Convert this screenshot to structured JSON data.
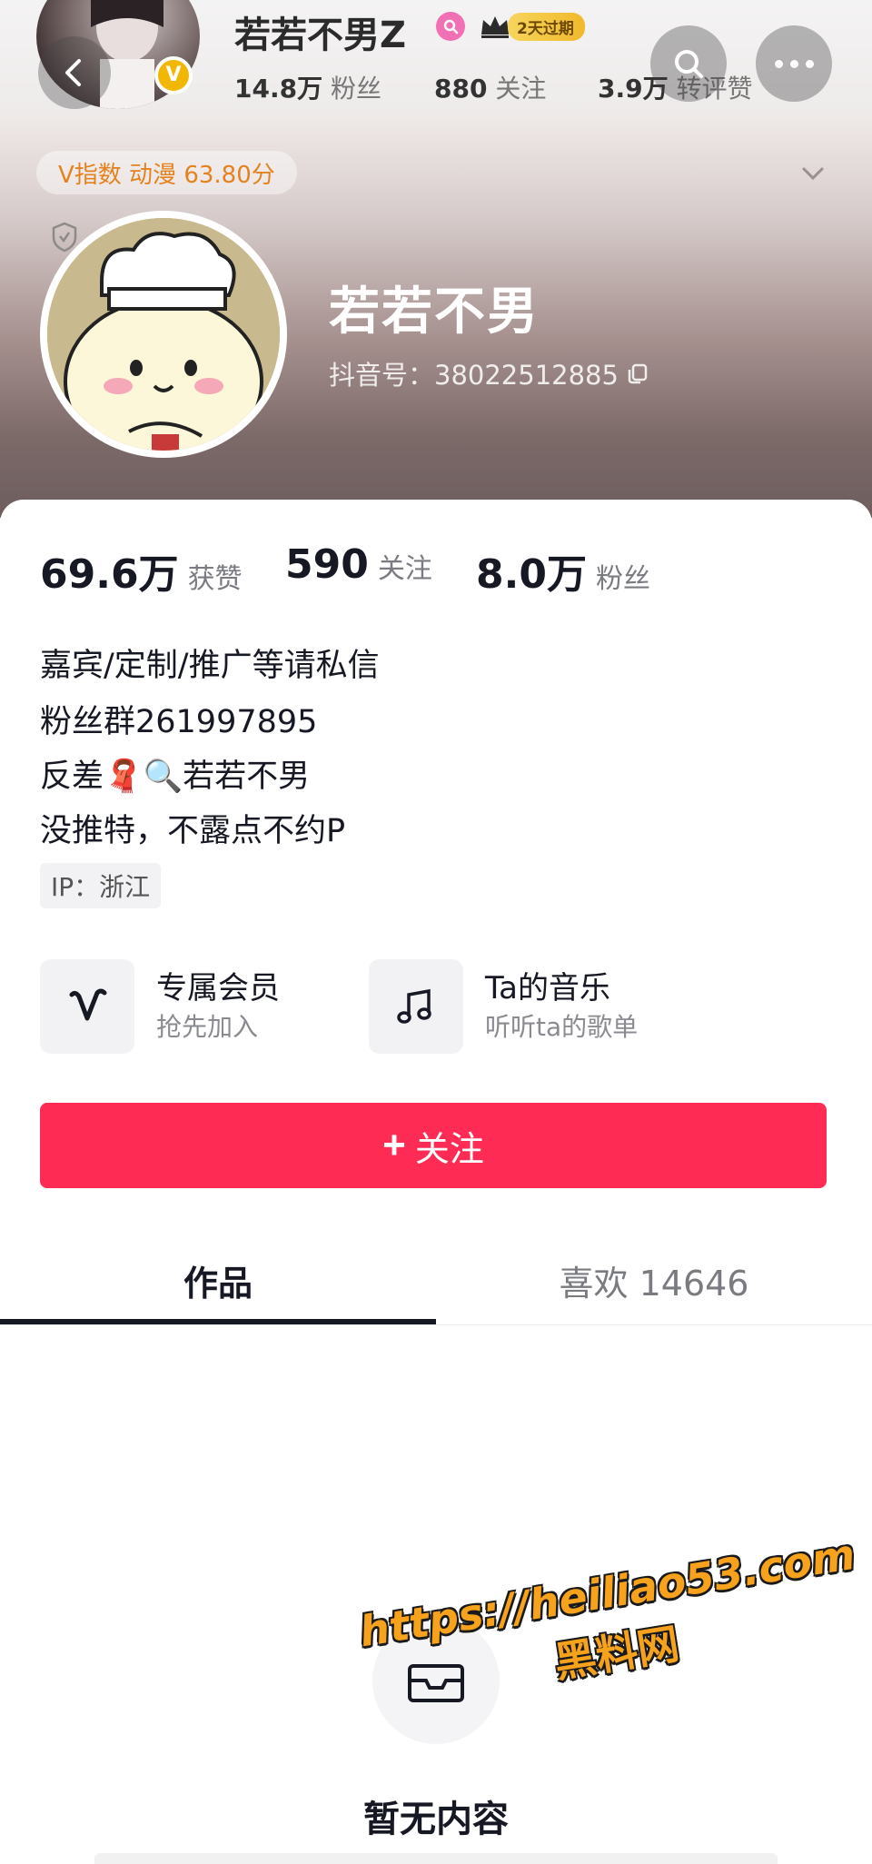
{
  "top_header": {
    "nickname": "若若不男Z",
    "badge_text": "2天过期",
    "stats": [
      {
        "value": "14.8万",
        "label": "粉丝"
      },
      {
        "value": "880",
        "label": "关注"
      },
      {
        "value": "3.9万",
        "label": "转评赞"
      }
    ],
    "verified_mark": "V"
  },
  "banner": {
    "v_index": "V指数 动漫 63.80分",
    "name": "若若不男",
    "douyin_id": "抖音号：38022512885"
  },
  "stats": [
    {
      "value": "69.6万",
      "label": "获赞"
    },
    {
      "value": "590",
      "label": "关注"
    },
    {
      "value": "8.0万",
      "label": "粉丝"
    }
  ],
  "bio": [
    "嘉宾/定制/推广等请私信",
    "粉丝群261997895",
    "反差🧣🔍若若不男",
    "没推特，不露点不约P"
  ],
  "ip_location": "IP：浙江",
  "features": [
    {
      "title": "专属会员",
      "subtitle": "抢先加入",
      "icon": "v-logo-icon"
    },
    {
      "title": "Ta的音乐",
      "subtitle": "听听ta的歌单",
      "icon": "music-note-icon"
    }
  ],
  "follow_button": {
    "plus": "+",
    "label": "关注"
  },
  "tabs": [
    {
      "label": "作品",
      "active": true
    },
    {
      "label": "喜欢 14646",
      "active": false
    }
  ],
  "empty_state": {
    "text": "暂无内容",
    "icon": "empty-box-icon"
  },
  "watermark": {
    "line1": "https://heiliao53.com",
    "line2": "黑料网"
  },
  "colors": {
    "accent": "#fe2c55",
    "v_index": "#e3821f",
    "watermark": "#f6a21c"
  }
}
